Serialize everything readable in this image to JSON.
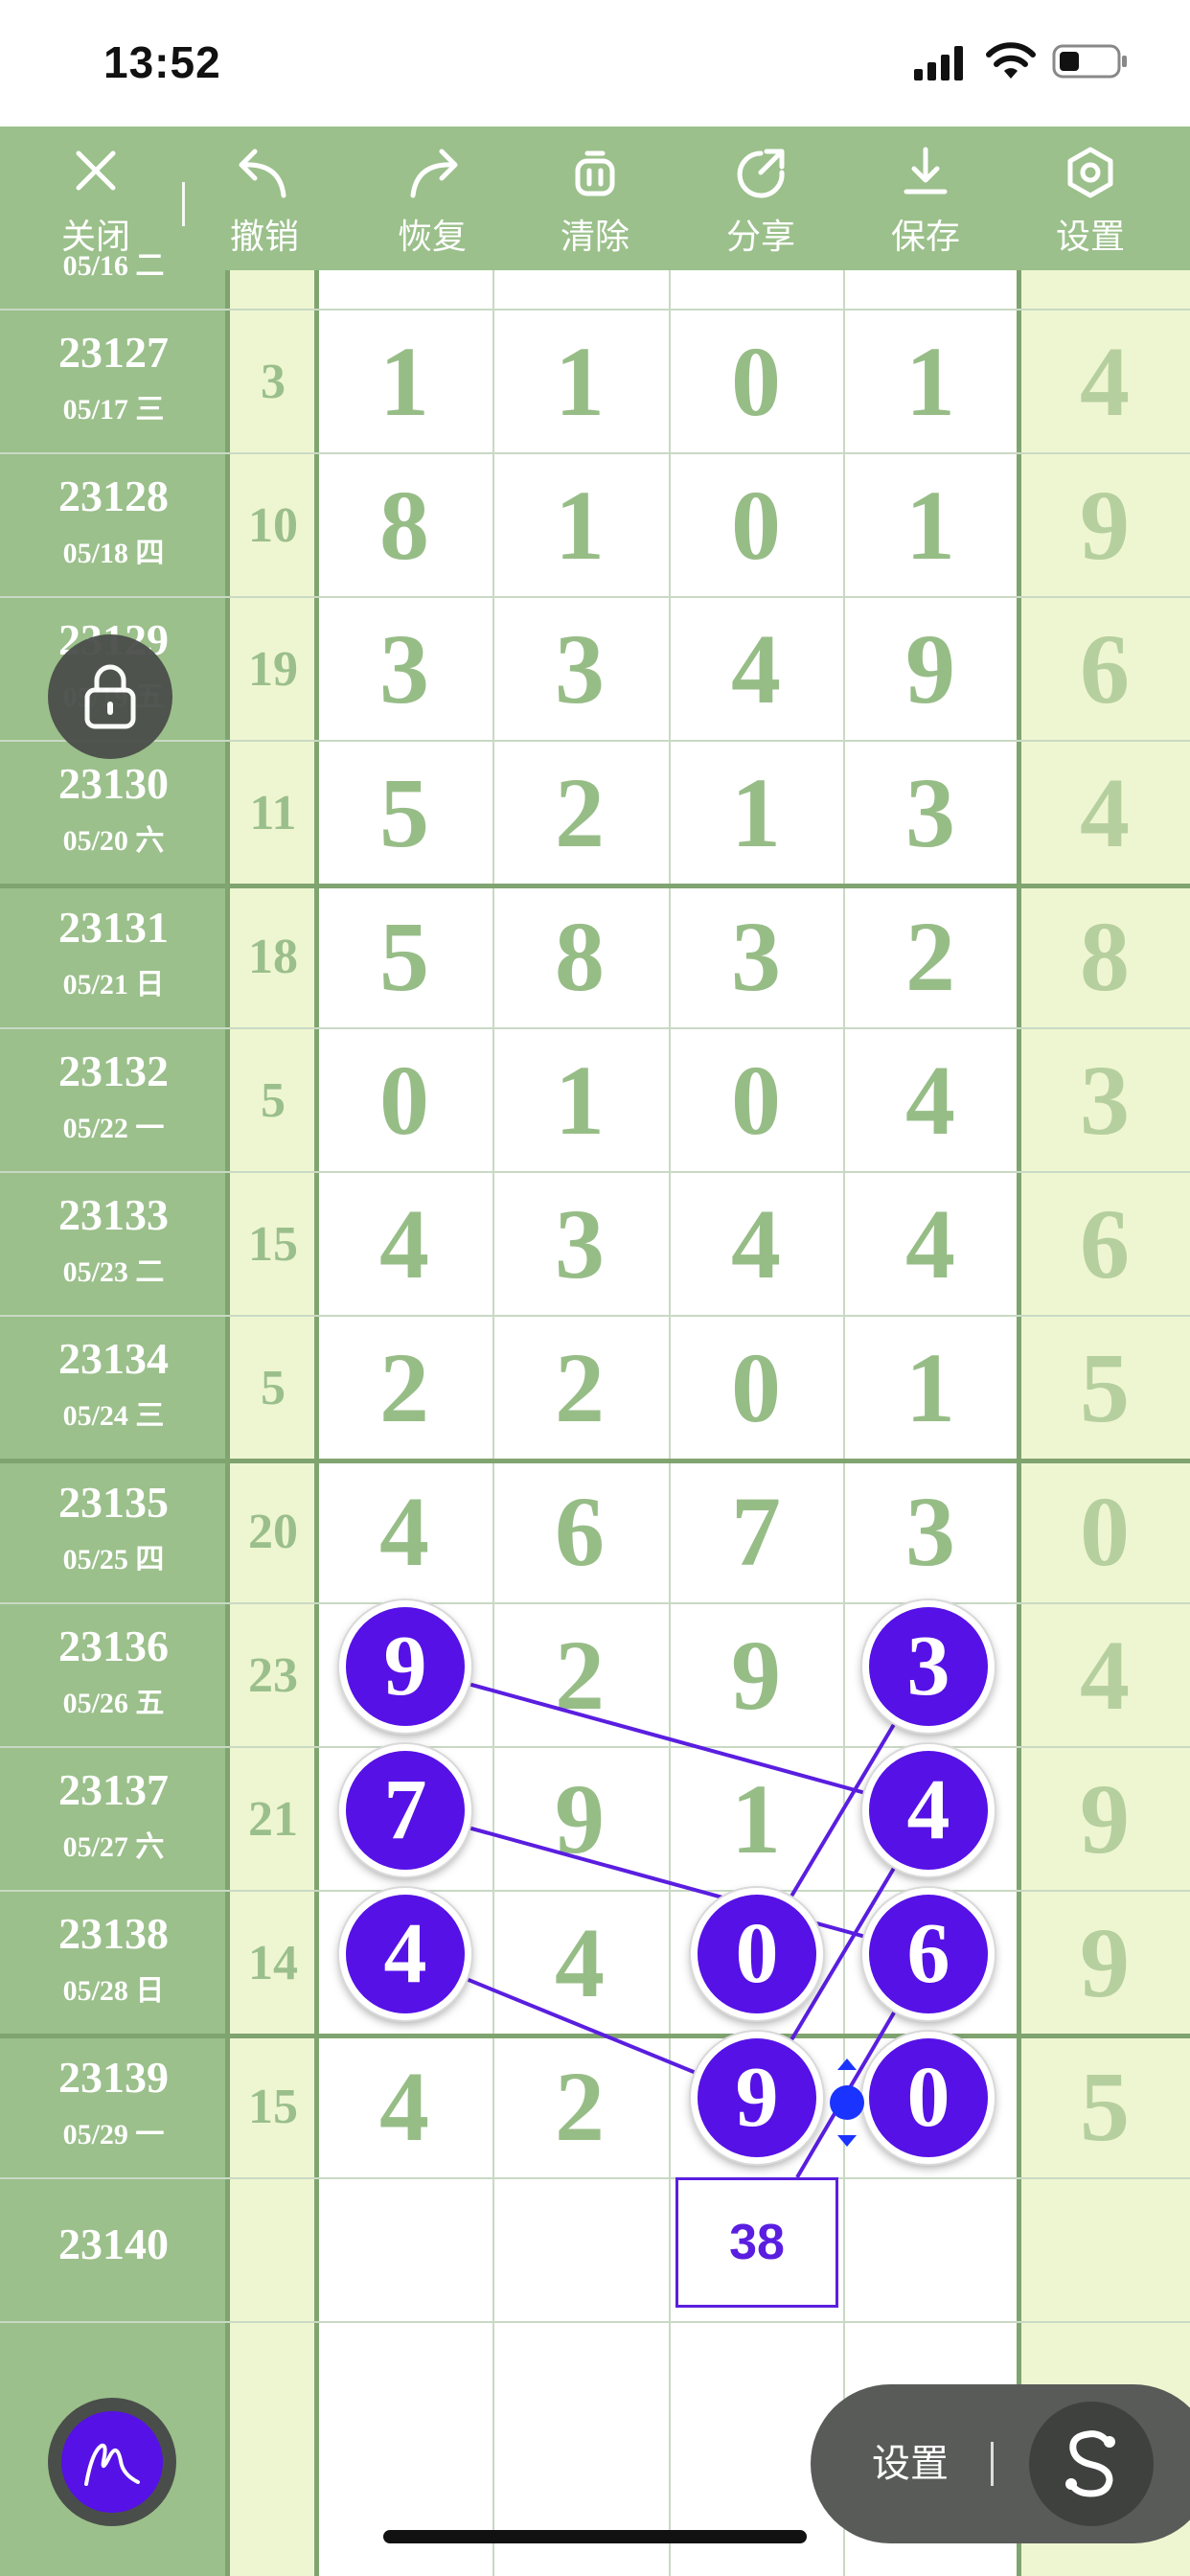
{
  "status_bar": {
    "time": "13:52"
  },
  "toolbar": {
    "items": [
      {
        "label": "关闭",
        "icon": "close-icon"
      },
      {
        "label": "撤销",
        "icon": "undo-icon"
      },
      {
        "label": "恢复",
        "icon": "redo-icon"
      },
      {
        "label": "清除",
        "icon": "trash-icon"
      },
      {
        "label": "分享",
        "icon": "share-icon"
      },
      {
        "label": "保存",
        "icon": "download-icon"
      },
      {
        "label": "设置",
        "icon": "settings-icon"
      }
    ]
  },
  "partial_top_row": {
    "date": "05/16 二"
  },
  "rows": [
    {
      "issue": "23127",
      "date": "05/17 三",
      "sum": "3",
      "digits": [
        "1",
        "1",
        "0",
        "1"
      ],
      "last": "4"
    },
    {
      "issue": "23128",
      "date": "05/18 四",
      "sum": "10",
      "digits": [
        "8",
        "1",
        "0",
        "1"
      ],
      "last": "9"
    },
    {
      "issue": "23129",
      "date": "05/19 五",
      "sum": "19",
      "digits": [
        "3",
        "3",
        "4",
        "9"
      ],
      "last": "6"
    },
    {
      "issue": "23130",
      "date": "05/20 六",
      "sum": "11",
      "digits": [
        "5",
        "2",
        "1",
        "3"
      ],
      "last": "4"
    },
    {
      "issue": "23131",
      "date": "05/21 日",
      "sum": "18",
      "digits": [
        "5",
        "8",
        "3",
        "2"
      ],
      "last": "8"
    },
    {
      "issue": "23132",
      "date": "05/22 一",
      "sum": "5",
      "digits": [
        "0",
        "1",
        "0",
        "4"
      ],
      "last": "3"
    },
    {
      "issue": "23133",
      "date": "05/23 二",
      "sum": "15",
      "digits": [
        "4",
        "3",
        "4",
        "4"
      ],
      "last": "6"
    },
    {
      "issue": "23134",
      "date": "05/24 三",
      "sum": "5",
      "digits": [
        "2",
        "2",
        "0",
        "1"
      ],
      "last": "5"
    },
    {
      "issue": "23135",
      "date": "05/25 四",
      "sum": "20",
      "digits": [
        "4",
        "6",
        "7",
        "3"
      ],
      "last": "0"
    },
    {
      "issue": "23136",
      "date": "05/26 五",
      "sum": "23",
      "digits": [
        "9",
        "2",
        "9",
        "3"
      ],
      "last": "4"
    },
    {
      "issue": "23137",
      "date": "05/27 六",
      "sum": "21",
      "digits": [
        "7",
        "9",
        "1",
        "4"
      ],
      "last": "9"
    },
    {
      "issue": "23138",
      "date": "05/28 日",
      "sum": "14",
      "digits": [
        "4",
        "4",
        "0",
        "6"
      ],
      "last": "9"
    },
    {
      "issue": "23139",
      "date": "05/29 一",
      "sum": "15",
      "digits": [
        "4",
        "2",
        "9",
        "0"
      ],
      "last": "5"
    },
    {
      "issue": "23140",
      "date": "",
      "sum": "",
      "digits": [
        "",
        "",
        "",
        ""
      ],
      "last": ""
    }
  ],
  "annotation_box": {
    "value": "38"
  },
  "floating": {
    "settings_label": "设置"
  },
  "colors": {
    "accent": "#5611e6",
    "toolbar_bg": "#9bc08b",
    "digit_green": "#97bd87",
    "sum_column_bg": "#eef6d1"
  }
}
